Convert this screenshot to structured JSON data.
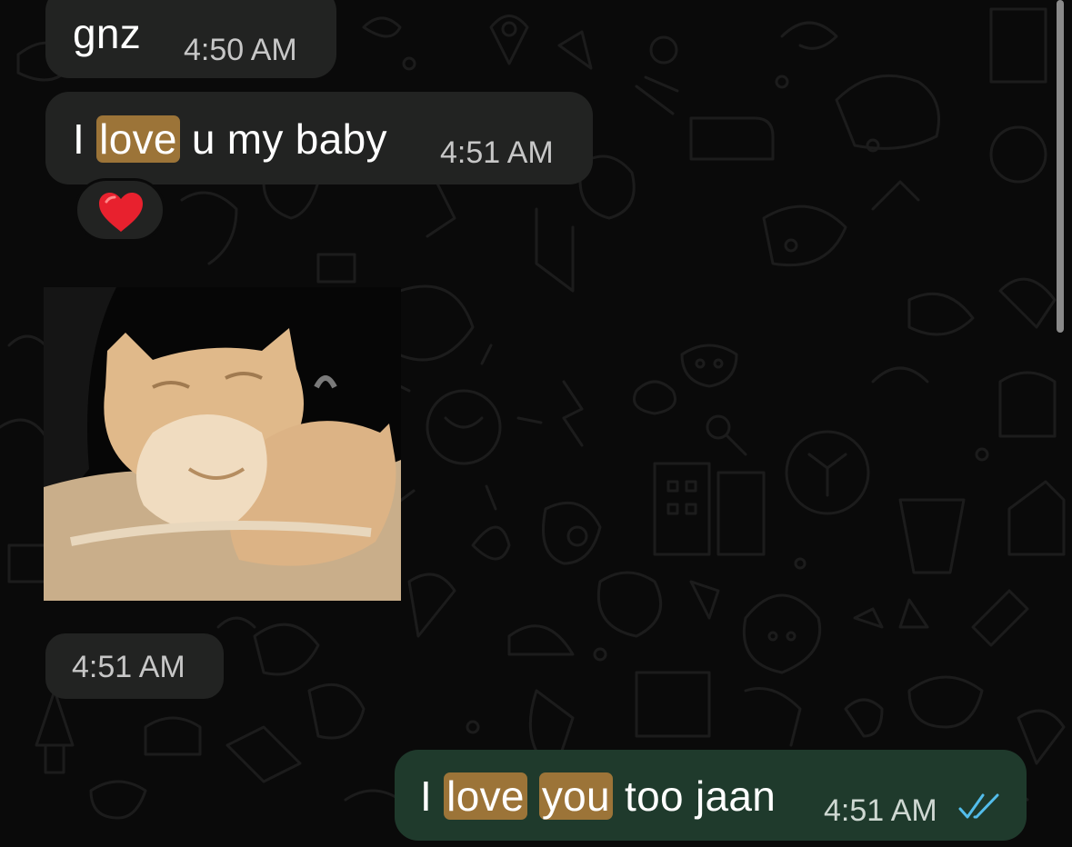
{
  "messages": [
    {
      "direction": "incoming",
      "text": "gnz",
      "time": "4:50 AM"
    },
    {
      "direction": "incoming",
      "text_before": "I ",
      "highlight": "love",
      "text_after": " u my baby",
      "time": "4:51 AM",
      "reaction": "red-heart"
    },
    {
      "direction": "incoming",
      "media": "gif",
      "media_subject": "cats-cuddling",
      "time": "4:51 AM"
    },
    {
      "direction": "outgoing",
      "text_before": "I ",
      "highlight_1": "love",
      "between": " ",
      "highlight_2": "you",
      "text_after": " too jaan",
      "time": "4:51 AM",
      "status": "read"
    }
  ],
  "colors": {
    "background": "#0a0a0a",
    "incoming_bubble": "#222322",
    "outgoing_bubble": "#1f3a2c",
    "search_highlight": "#9c7438",
    "read_ticks": "#53bdeb",
    "reaction_heart": "#e8212e"
  },
  "icons": [
    "red-heart-reaction",
    "double-check-read-icon",
    "scrollbar"
  ]
}
